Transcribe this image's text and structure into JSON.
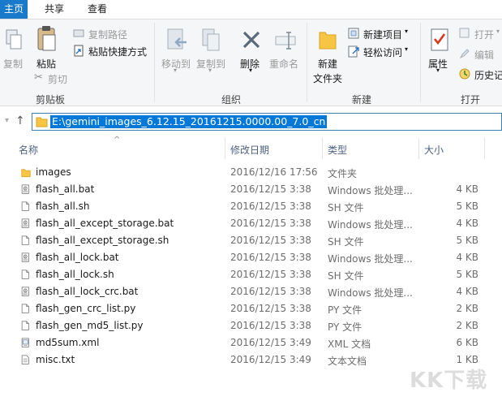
{
  "ribbon_tabs": [
    "主页",
    "共享",
    "查看"
  ],
  "ribbon": {
    "clipboard": {
      "copy": "复制",
      "paste": "粘贴",
      "copy_path": "复制路径",
      "paste_shortcut": "粘贴快捷方式",
      "cut": "剪切",
      "group_label": "剪贴板"
    },
    "organize": {
      "move_to": "移动到",
      "copy_to": "复制到",
      "delete": "删除",
      "rename": "重命名",
      "group_label": "组织"
    },
    "new": {
      "new_folder": "新建",
      "new_folder_line2": "文件夹",
      "new_item": "新建项目",
      "easy_access": "轻松访问",
      "group_label": "新建"
    },
    "open": {
      "properties": "属性",
      "open": "打开",
      "edit": "编辑",
      "history": "历史记",
      "group_label": "打开"
    }
  },
  "address": {
    "path": "E:\\gemini_images_6.12.15_20161215.0000.00_7.0_cn"
  },
  "columns": {
    "name": "名称",
    "date": "修改日期",
    "type": "类型",
    "size": "大小"
  },
  "files": [
    {
      "name": "images",
      "date": "2016/12/16 17:56",
      "type": "文件夹",
      "size": "",
      "icon": "folder-icon"
    },
    {
      "name": "flash_all.bat",
      "date": "2016/12/15 3:38",
      "type": "Windows 批处理...",
      "size": "4 KB",
      "icon": "batch-file-icon"
    },
    {
      "name": "flash_all.sh",
      "date": "2016/12/15 3:38",
      "type": "SH 文件",
      "size": "5 KB",
      "icon": "file-icon"
    },
    {
      "name": "flash_all_except_storage.bat",
      "date": "2016/12/15 3:38",
      "type": "Windows 批处理...",
      "size": "4 KB",
      "icon": "batch-file-icon"
    },
    {
      "name": "flash_all_except_storage.sh",
      "date": "2016/12/15 3:38",
      "type": "SH 文件",
      "size": "5 KB",
      "icon": "file-icon"
    },
    {
      "name": "flash_all_lock.bat",
      "date": "2016/12/15 3:38",
      "type": "Windows 批处理...",
      "size": "4 KB",
      "icon": "batch-file-icon"
    },
    {
      "name": "flash_all_lock.sh",
      "date": "2016/12/15 3:38",
      "type": "SH 文件",
      "size": "5 KB",
      "icon": "file-icon"
    },
    {
      "name": "flash_all_lock_crc.bat",
      "date": "2016/12/15 3:38",
      "type": "Windows 批处理...",
      "size": "4 KB",
      "icon": "batch-file-icon"
    },
    {
      "name": "flash_gen_crc_list.py",
      "date": "2016/12/15 3:38",
      "type": "PY 文件",
      "size": "2 KB",
      "icon": "file-icon"
    },
    {
      "name": "flash_gen_md5_list.py",
      "date": "2016/12/15 3:38",
      "type": "PY 文件",
      "size": "2 KB",
      "icon": "file-icon"
    },
    {
      "name": "md5sum.xml",
      "date": "2016/12/15 3:49",
      "type": "XML 文档",
      "size": "6 KB",
      "icon": "xml-file-icon"
    },
    {
      "name": "misc.txt",
      "date": "2016/12/15 3:49",
      "type": "文本文档",
      "size": "1 KB",
      "icon": "text-file-icon"
    }
  ],
  "watermark": "KK下载",
  "colors": {
    "active_tab": "#1979ca",
    "selection": "#0078d7",
    "folder": "#f6c544"
  }
}
